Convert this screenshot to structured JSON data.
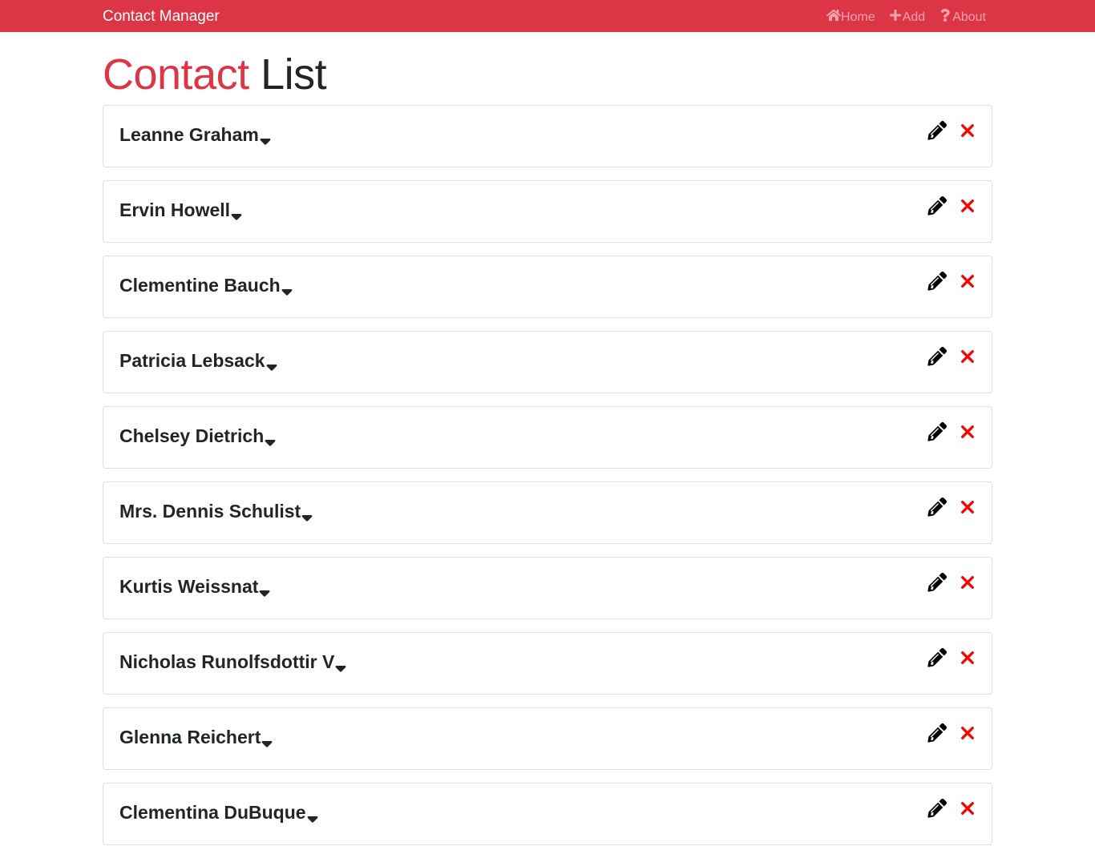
{
  "navbar": {
    "brand": "Contact Manager",
    "links": [
      {
        "label": "Home",
        "icon": "home-icon"
      },
      {
        "label": "Add",
        "icon": "plus-icon"
      },
      {
        "label": "About",
        "icon": "question-icon"
      }
    ]
  },
  "page": {
    "title_accent": "Contact",
    "title_rest": " List"
  },
  "contacts": [
    {
      "name": "Leanne Graham"
    },
    {
      "name": "Ervin Howell"
    },
    {
      "name": "Clementine Bauch"
    },
    {
      "name": "Patricia Lebsack"
    },
    {
      "name": "Chelsey Dietrich"
    },
    {
      "name": "Mrs. Dennis Schulist"
    },
    {
      "name": "Kurtis Weissnat"
    },
    {
      "name": "Nicholas Runolfsdottir V"
    },
    {
      "name": "Glenna Reichert"
    },
    {
      "name": "Clementina DuBuque"
    }
  ],
  "colors": {
    "brand": "#dc3545",
    "delete": "#ff0000",
    "text": "#212529"
  },
  "icons": {
    "expand": "caret-down-icon",
    "edit": "pencil-icon",
    "delete": "times-icon"
  }
}
